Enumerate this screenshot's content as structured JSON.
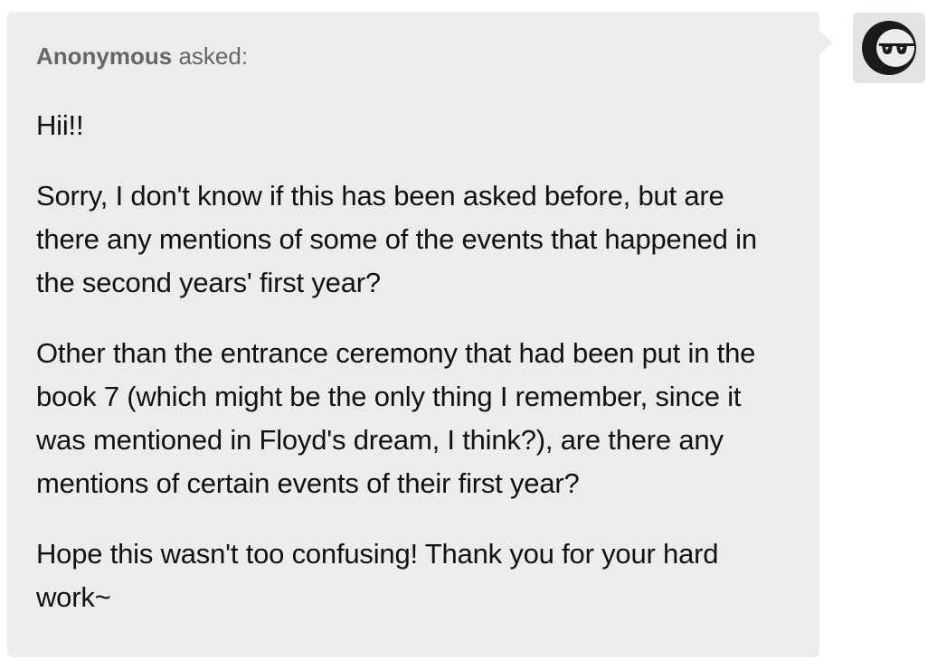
{
  "ask": {
    "asker_name": "Anonymous",
    "asker_verb": "asked:",
    "paragraphs": [
      "Hii!!",
      "Sorry, I don't know if this has been asked before, but are there any mentions of some of the events that happened in the second years' first year?",
      "Other than the entrance ceremony that had been put in the book 7 (which might be the only thing I remember, since it was mentioned in Floyd's dream, I think?), are there any mentions of certain events of their first year?",
      "Hope this wasn't too confusing!  Thank you for your hard work~"
    ]
  },
  "avatar": {
    "icon": "anonymous-sunglasses-moon-icon"
  },
  "colors": {
    "bubble": "#ececec",
    "avatar_bg": "#e3e3e3",
    "asker_text": "#666666",
    "body_text": "#111111"
  }
}
